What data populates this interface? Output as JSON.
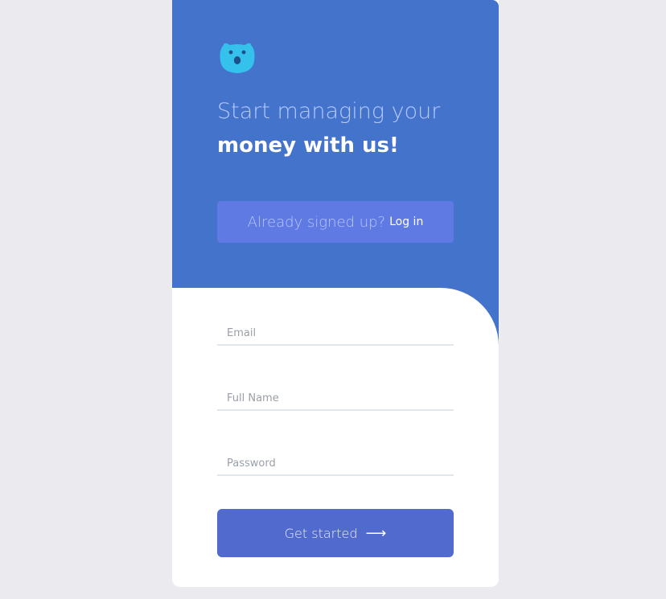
{
  "header": {
    "logo_icon": "bear-face-icon",
    "headline_line1": "Start managing your",
    "headline_line2": "money with us!"
  },
  "login_prompt": {
    "text": "Already signed up?",
    "link_label": "Log in"
  },
  "form": {
    "email_placeholder": "Email",
    "full_name_placeholder": "Full Name",
    "password_placeholder": "Password",
    "submit_label": "Get started",
    "submit_icon": "arrow-right-icon"
  },
  "colors": {
    "background": "#ebeaef",
    "header_blue": "#4473cc",
    "login_box": "#5f7ae3",
    "button": "#516ace",
    "logo_cyan": "#34c2ec"
  }
}
